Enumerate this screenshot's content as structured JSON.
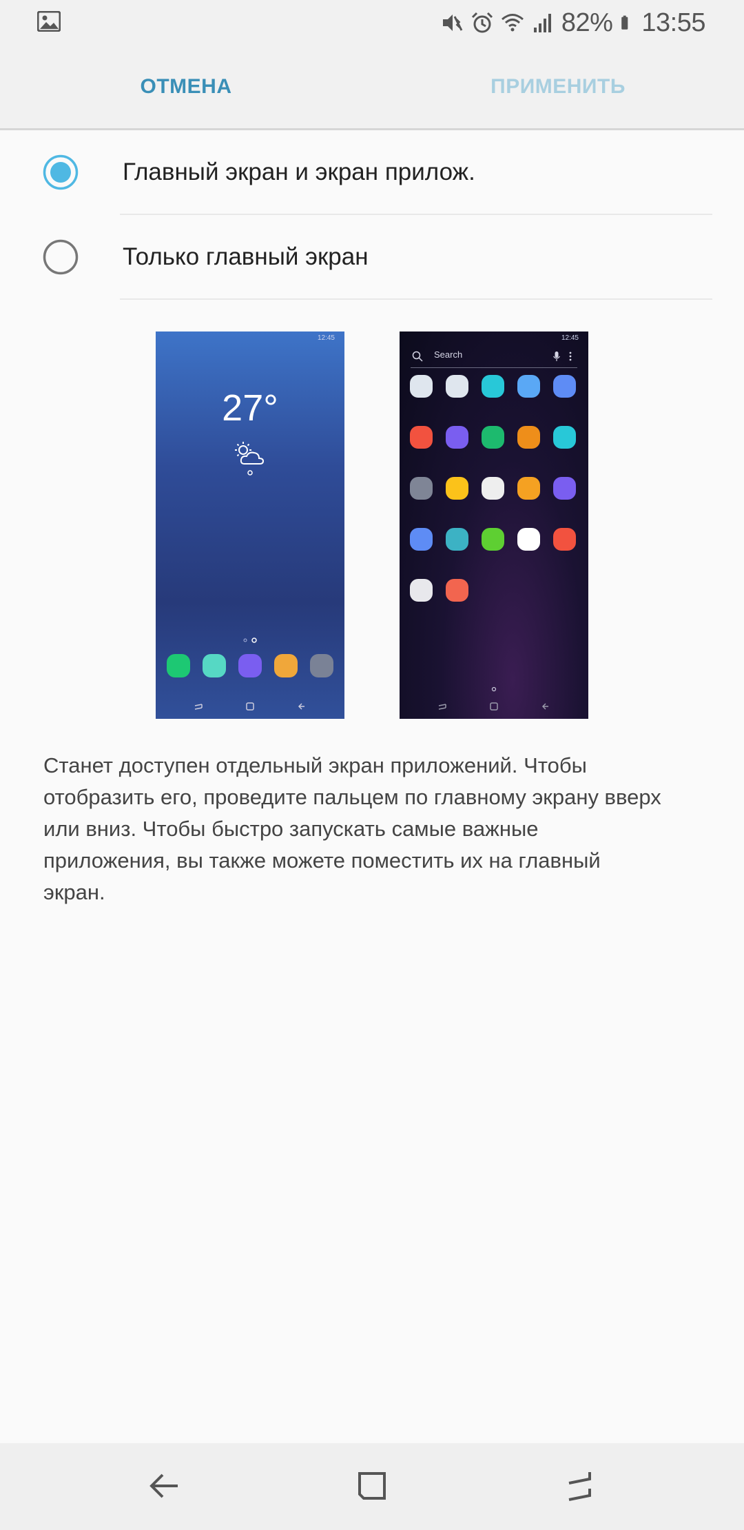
{
  "status_bar": {
    "battery": "82%",
    "time": "13:55"
  },
  "top_bar": {
    "cancel_label": "ОТМЕНА",
    "apply_label": "ПРИМЕНИТЬ"
  },
  "options": [
    {
      "label": "Главный экран и экран прилож.",
      "selected": true
    },
    {
      "label": "Только главный экран",
      "selected": false
    }
  ],
  "preview_home": {
    "status_time": "12:45",
    "temperature": "27°",
    "dock_colors": [
      "#1dc873",
      "#56d8c4",
      "#7a5ef0",
      "#f0a73a",
      "#7a8296"
    ]
  },
  "preview_apps": {
    "status_time": "12:45",
    "search_placeholder": "Search",
    "app_colors": [
      [
        "#dfe6ee",
        "#dfe6ee",
        "#28c8d8",
        "#5aa8f5",
        "#5e8cf5"
      ],
      [
        "#f2523f",
        "#7a5ef0",
        "#1dba6e",
        "#ee8e1a",
        "#28c8d8"
      ],
      [
        "#7f8596",
        "#fbc21a",
        "#eeeeee",
        "#f5a122",
        "#7a5ef0"
      ],
      [
        "#5e8cf5",
        "#3cb2c4",
        "#5ecf32",
        "#ffffff",
        "#f2523f"
      ],
      [
        "#e8e8ec",
        "#f2654f"
      ]
    ]
  },
  "description": "Станет доступен отдельный экран приложений. Чтобы отобразить его, проведите пальцем по главному экрану вверх или вниз. Чтобы быстро запускать самые важные приложения, вы также можете поместить их на главный экран.",
  "colors": {
    "accent": "#3a8fb7",
    "accent_disabled": "#a8cfe0",
    "radio_selected": "#4fb8e3"
  }
}
